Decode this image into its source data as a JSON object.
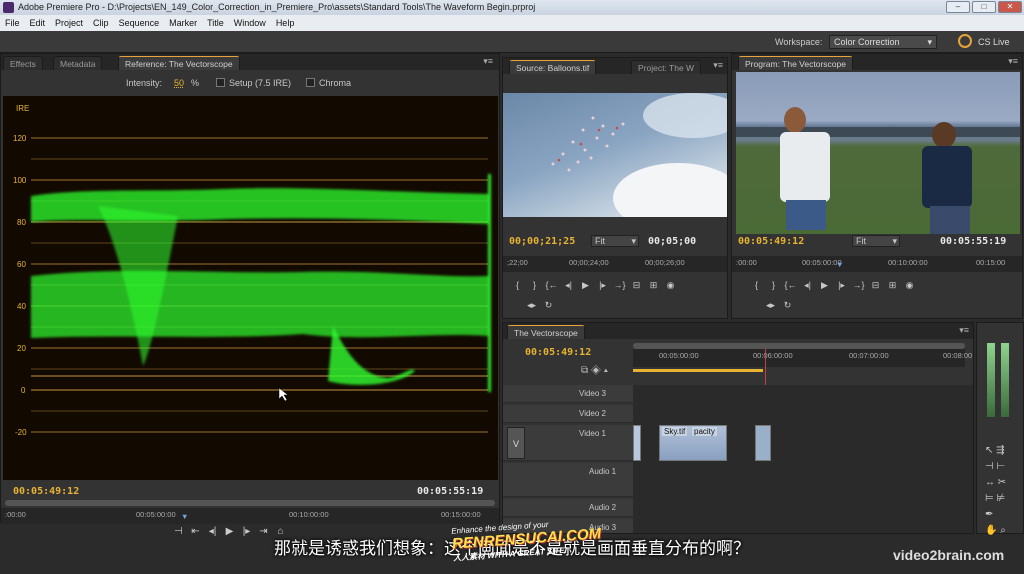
{
  "titlebar": {
    "title": "Adobe Premiere Pro - D:\\Projects\\EN_149_Color_Correction_in_Premiere_Pro\\assets\\Standard Tools\\The Waveform Begin.prproj",
    "min": "–",
    "max": "□",
    "close": "✕"
  },
  "menu": [
    "File",
    "Edit",
    "Project",
    "Clip",
    "Sequence",
    "Marker",
    "Title",
    "Window",
    "Help"
  ],
  "workspace": {
    "label": "Workspace:",
    "value": "Color Correction",
    "cslive": "CS Live"
  },
  "left_panel": {
    "tabs": [
      "Effects",
      "Metadata",
      "Reference: The Vectorscope"
    ],
    "intensity_label": "Intensity:",
    "intensity_value": "50",
    "intensity_unit": "%",
    "setup_label": "Setup (7.5 IRE)",
    "chroma_label": "Chroma",
    "ire_label": "IRE",
    "ire_ticks": [
      "120",
      "100",
      "80",
      "60",
      "40",
      "20",
      "0",
      "-20"
    ],
    "timecode_left": "00:05:49:12",
    "timecode_right": "00:05:55:19",
    "ruler": [
      ":00:00",
      "00:05:00:00",
      "00:10:00:00",
      "00:15:00:00"
    ]
  },
  "source_panel": {
    "tabs": [
      "Source: Balloons.tif",
      "Project: The W"
    ],
    "timecode": "00;00;21;25",
    "fit": "Fit",
    "duration": "00;05;00",
    "ruler": [
      ";22;00",
      "00;00;24;00",
      "00;00;26;00"
    ]
  },
  "program_panel": {
    "tab": "Program: The Vectorscope",
    "timecode": "00:05:49:12",
    "fit": "Fit",
    "duration": "00:05:55:19",
    "ruler": [
      ":00:00",
      "00:05:00:00",
      "00:10:00:00",
      "00:15:00"
    ]
  },
  "timeline": {
    "tab": "The Vectorscope",
    "timecode": "00:05:49:12",
    "ruler": [
      "00:05:00:00",
      "00:06:00:00",
      "00:07:00:00",
      "00:08:00:00"
    ],
    "tracks": [
      "Video 3",
      "Video 2",
      "Video 1",
      "Audio 1",
      "Audio 2",
      "Audio 3"
    ],
    "clip_label": "Sky.tif",
    "clip_effect": "pacity",
    "track_target": "V"
  },
  "subtitle": "那就是诱惑我们想象：这个画面是不是就是画面垂直分布的啊？",
  "watermarks": {
    "renren_top": "Enhance the design of your",
    "renren_main": "RENRENSUCAI.COM",
    "renren_sub": "人人素材 WITH A GREAT SITE!",
    "v2b": "video2brain.com"
  },
  "colors": {
    "accent": "#e8b331",
    "waveform": "#2fff2f",
    "graticule": "#d9a24a"
  }
}
